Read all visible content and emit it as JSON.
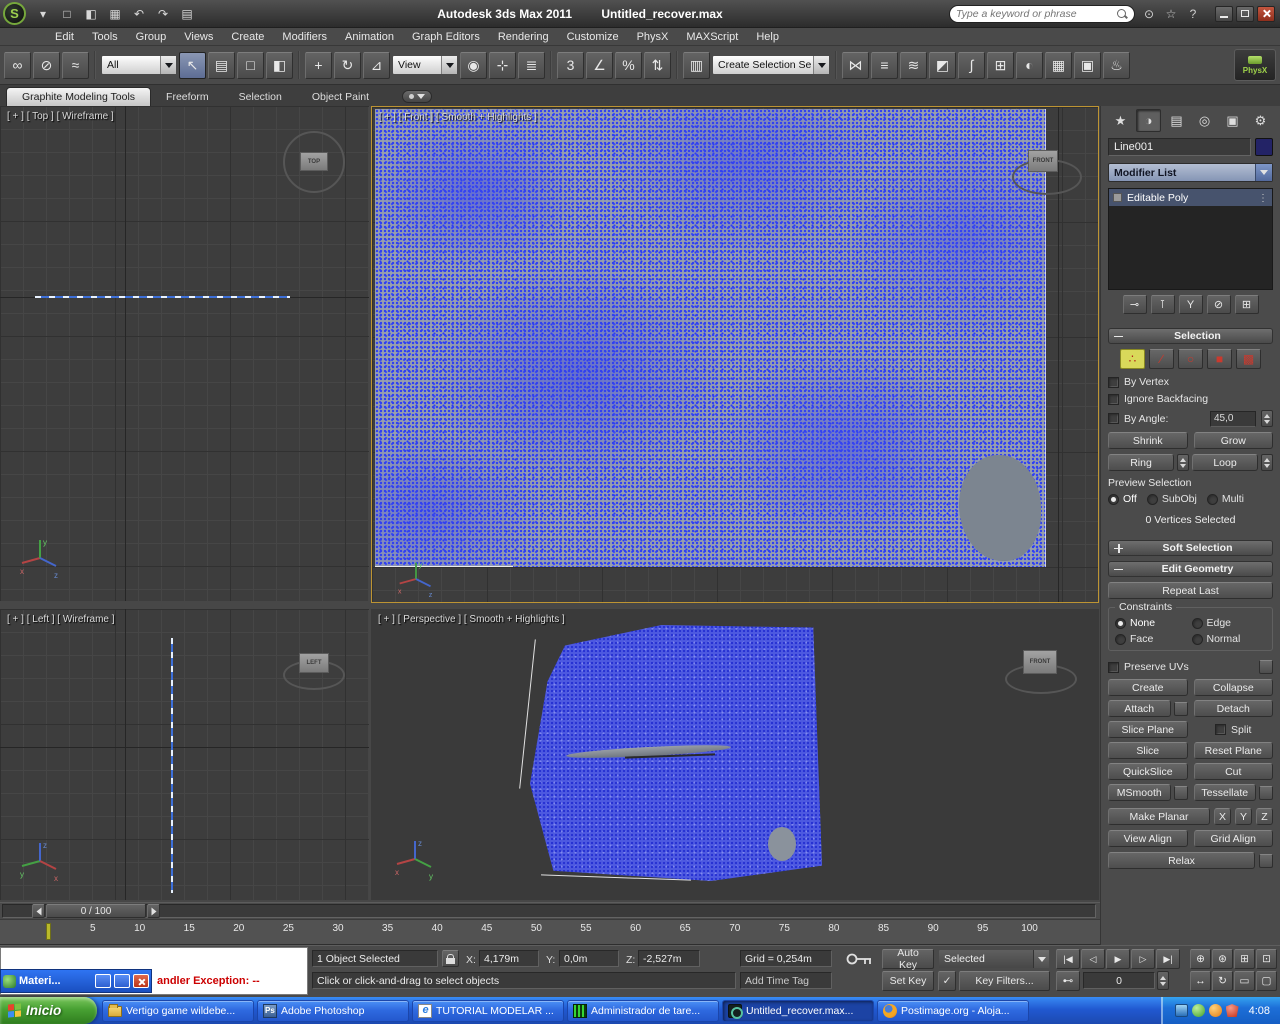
{
  "colors": {
    "active_viewport_border": "#bd9433",
    "vertex_selection_blue": "#3d4df2",
    "taskbar_blue": "#2159d1",
    "start_button_green": "#48a133",
    "error_text_red": "#cc0000",
    "subobject_active_yellow": "#d9d95a"
  },
  "titlebar": {
    "app_title": "Autodesk 3ds Max  2011",
    "doc_title": "Untitled_recover.max",
    "search_placeholder": "Type a keyword or phrase",
    "quick_access": [
      {
        "name": "application-menu-arrow-icon",
        "glyph": "▾"
      },
      {
        "name": "new-scene-button",
        "glyph": "□"
      },
      {
        "name": "open-file-button",
        "glyph": "◧"
      },
      {
        "name": "save-file-button",
        "glyph": "▦"
      },
      {
        "name": "undo-button",
        "glyph": "↶"
      },
      {
        "name": "redo-button",
        "glyph": "↷"
      },
      {
        "name": "project-folder-button",
        "glyph": "▤"
      }
    ],
    "info_icons": [
      {
        "name": "communication-center-icon",
        "glyph": "⊙"
      },
      {
        "name": "favorites-icon",
        "glyph": "☆"
      },
      {
        "name": "infocenter-help-icon",
        "glyph": "?"
      }
    ]
  },
  "menu": [
    "Edit",
    "Tools",
    "Group",
    "Views",
    "Create",
    "Modifiers",
    "Animation",
    "Graph Editors",
    "Rendering",
    "Customize",
    "PhysX",
    "MAXScript",
    "Help"
  ],
  "toolbar": {
    "selection_filter_value": "All",
    "coord_system_value": "View",
    "selection_set_value": "Create Selection Se",
    "physx_label": "PhysX",
    "icons_left": [
      {
        "name": "select-and-link",
        "glyph": "∞"
      },
      {
        "name": "unlink-selection",
        "glyph": "⊘"
      },
      {
        "name": "bind-to-space-warp",
        "glyph": "≈"
      }
    ],
    "icons_select": [
      {
        "name": "select-object",
        "glyph": "↖",
        "active": true
      },
      {
        "name": "select-by-name",
        "glyph": "▤"
      },
      {
        "name": "rectangular-selection-region",
        "glyph": "□"
      },
      {
        "name": "window-crossing-toggle",
        "glyph": "◧"
      }
    ],
    "icons_transform": [
      {
        "name": "select-and-move",
        "glyph": "+"
      },
      {
        "name": "select-and-rotate",
        "glyph": "↻"
      },
      {
        "name": "select-and-scale",
        "glyph": "⊿"
      }
    ],
    "icons_pivot": [
      {
        "name": "use-pivot-point-center",
        "glyph": "◉"
      },
      {
        "name": "select-and-manipulate",
        "glyph": "⊹"
      },
      {
        "name": "keyboard-shortcut-override",
        "glyph": "≣"
      }
    ],
    "icons_snap": [
      {
        "name": "snaps-toggle",
        "glyph": "3"
      },
      {
        "name": "angle-snap-toggle",
        "glyph": "∠"
      },
      {
        "name": "percent-snap-toggle",
        "glyph": "%"
      },
      {
        "name": "spinner-snap-toggle",
        "glyph": "⇅"
      }
    ],
    "icons_sets": [
      {
        "name": "edit-named-selection-sets",
        "glyph": "▥"
      }
    ],
    "icons_right": [
      {
        "name": "mirror",
        "glyph": "⋈"
      },
      {
        "name": "align",
        "glyph": "≡"
      },
      {
        "name": "layer-manager",
        "glyph": "≋"
      },
      {
        "name": "graphite-modeling-tools-toggle",
        "glyph": "◩"
      },
      {
        "name": "curve-editor",
        "glyph": "∫"
      },
      {
        "name": "schematic-view",
        "glyph": "⊞"
      },
      {
        "name": "material-editor",
        "glyph": "◐"
      },
      {
        "name": "render-setup",
        "glyph": "▦"
      },
      {
        "name": "rendered-frame-window",
        "glyph": "▣"
      },
      {
        "name": "render-production",
        "glyph": "♨"
      }
    ]
  },
  "ribbon": {
    "tabs": [
      {
        "label": "Graphite Modeling Tools",
        "active": true
      },
      {
        "label": "Freeform"
      },
      {
        "label": "Selection"
      },
      {
        "label": "Object Paint"
      }
    ]
  },
  "viewports": {
    "top": {
      "label": "[ + ] [ Top ] [ Wireframe ]",
      "gizmo": "TOP"
    },
    "front": {
      "label": "[ + ] [ Front ] [ Smooth + Highlights ]",
      "gizmo": "FRONT"
    },
    "left": {
      "label": "[ + ] [ Left ] [ Wireframe ]",
      "gizmo": "LEFT"
    },
    "perspective": {
      "label": "[ + ] [ Perspective ] [ Smooth + Highlights ]",
      "gizmo": "FRONT"
    }
  },
  "timeline": {
    "slider_label": "0 / 100",
    "ticks": [
      "5",
      "10",
      "15",
      "20",
      "25",
      "30",
      "35",
      "40",
      "45",
      "50",
      "55",
      "60",
      "65",
      "70",
      "75",
      "80",
      "85",
      "90",
      "95",
      "100"
    ]
  },
  "command_panel": {
    "tabs": [
      {
        "name": "create-tab",
        "glyph": "★"
      },
      {
        "name": "modify-tab",
        "glyph": "◑",
        "active": true
      },
      {
        "name": "hierarchy-tab",
        "glyph": "▤"
      },
      {
        "name": "motion-tab",
        "glyph": "◎"
      },
      {
        "name": "display-tab",
        "glyph": "▣"
      },
      {
        "name": "utilities-tab",
        "glyph": "⚙"
      }
    ],
    "object_name": "Line001",
    "modifier_list_label": "Modifier List",
    "stack": [
      {
        "label": "Editable Poly",
        "active": true
      }
    ],
    "stack_tools": [
      {
        "name": "pin-stack",
        "glyph": "⊸"
      },
      {
        "name": "show-end-result",
        "glyph": "⊺"
      },
      {
        "name": "make-unique",
        "glyph": "Y"
      },
      {
        "name": "remove-modifier",
        "glyph": "⊘"
      },
      {
        "name": "configure-modifier-sets",
        "glyph": "⊞"
      }
    ],
    "selection": {
      "title": "Selection",
      "subobject": [
        {
          "name": "subobject-vertex",
          "glyph": "∴",
          "active": true
        },
        {
          "name": "subobject-edge",
          "glyph": "∕"
        },
        {
          "name": "subobject-border",
          "glyph": "○"
        },
        {
          "name": "subobject-polygon",
          "glyph": "■"
        },
        {
          "name": "subobject-element",
          "glyph": "▩"
        }
      ],
      "by_vertex": "By Vertex",
      "ignore_backfacing": "Ignore Backfacing",
      "by_angle": "By Angle:",
      "by_angle_value": "45,0",
      "shrink": "Shrink",
      "grow": "Grow",
      "ring": "Ring",
      "loop": "Loop",
      "preview_label": "Preview Selection",
      "preview_options": [
        {
          "label": "Off",
          "checked": true
        },
        {
          "label": "SubObj"
        },
        {
          "label": "Multi"
        }
      ],
      "status": "0 Vertices Selected"
    },
    "soft_selection_title": "Soft Selection",
    "edit_geometry": {
      "title": "Edit Geometry",
      "repeat_last": "Repeat Last",
      "constraints_label": "Constraints",
      "constraints": [
        {
          "label": "None",
          "checked": true
        },
        {
          "label": "Edge"
        },
        {
          "label": "Face"
        },
        {
          "label": "Normal"
        }
      ],
      "preserve_uvs": "Preserve UVs",
      "create": "Create",
      "collapse": "Collapse",
      "attach": "Attach",
      "detach": "Detach",
      "slice_plane": "Slice Plane",
      "split": "Split",
      "slice": "Slice",
      "reset_plane": "Reset Plane",
      "quickslice": "QuickSlice",
      "cut": "Cut",
      "msmooth": "MSmooth",
      "tessellate": "Tessellate",
      "make_planar": "Make Planar",
      "x": "X",
      "y": "Y",
      "z": "Z",
      "view_align": "View Align",
      "grid_align": "Grid Align",
      "relax": "Relax"
    }
  },
  "status_bar": {
    "selection_info": "1 Object Selected",
    "prompt": "Click or click-and-drag to select objects",
    "x_label": "X:",
    "x_value": "4,179m",
    "y_label": "Y:",
    "y_value": "0,0m",
    "z_label": "Z:",
    "z_value": "-2,527m",
    "grid_value": "Grid = 0,254m",
    "add_time_tag": "Add Time Tag",
    "auto_key": "Auto Key",
    "set_key": "Set Key",
    "selected_dropdown": "Selected",
    "key_filters": "Key Filters...",
    "frame_value": "0",
    "playback": [
      {
        "name": "go-to-start",
        "glyph": "|◀"
      },
      {
        "name": "previous-frame",
        "glyph": "◁"
      },
      {
        "name": "play-animation",
        "glyph": "▶"
      },
      {
        "name": "next-frame",
        "glyph": "▷"
      },
      {
        "name": "go-to-end",
        "glyph": "▶|"
      }
    ],
    "key_mode_glyph": "⊷",
    "nav_row1": [
      {
        "name": "zoom",
        "glyph": "⊕"
      },
      {
        "name": "zoom-all",
        "glyph": "⊛"
      },
      {
        "name": "zoom-extents",
        "glyph": "⊞"
      },
      {
        "name": "zoom-region",
        "glyph": "⊡"
      }
    ],
    "nav_row2": [
      {
        "name": "pan-view",
        "glyph": "↔"
      },
      {
        "name": "orbit-view",
        "glyph": "↻"
      },
      {
        "name": "field-of-view",
        "glyph": "▭"
      },
      {
        "name": "maximize-viewport-toggle",
        "glyph": "▢"
      }
    ]
  },
  "error_window": {
    "title": "Materi...",
    "exception_text": "andler Exception: --"
  },
  "taskbar": {
    "start_label": "Inicio",
    "items": [
      {
        "label": "Vertigo game wildebe...",
        "icon": "folder"
      },
      {
        "label": "Adobe Photoshop",
        "icon": "photoshop"
      },
      {
        "label": "TUTORIAL MODELAR ...",
        "icon": "iedoc"
      },
      {
        "label": "Administrador de tare...",
        "icon": "taskmgr"
      },
      {
        "label": "Untitled_recover.max...",
        "icon": "max",
        "active": true
      },
      {
        "label": "Postimage.org - Aloja...",
        "icon": "firefox"
      }
    ],
    "clock": "4:08"
  }
}
